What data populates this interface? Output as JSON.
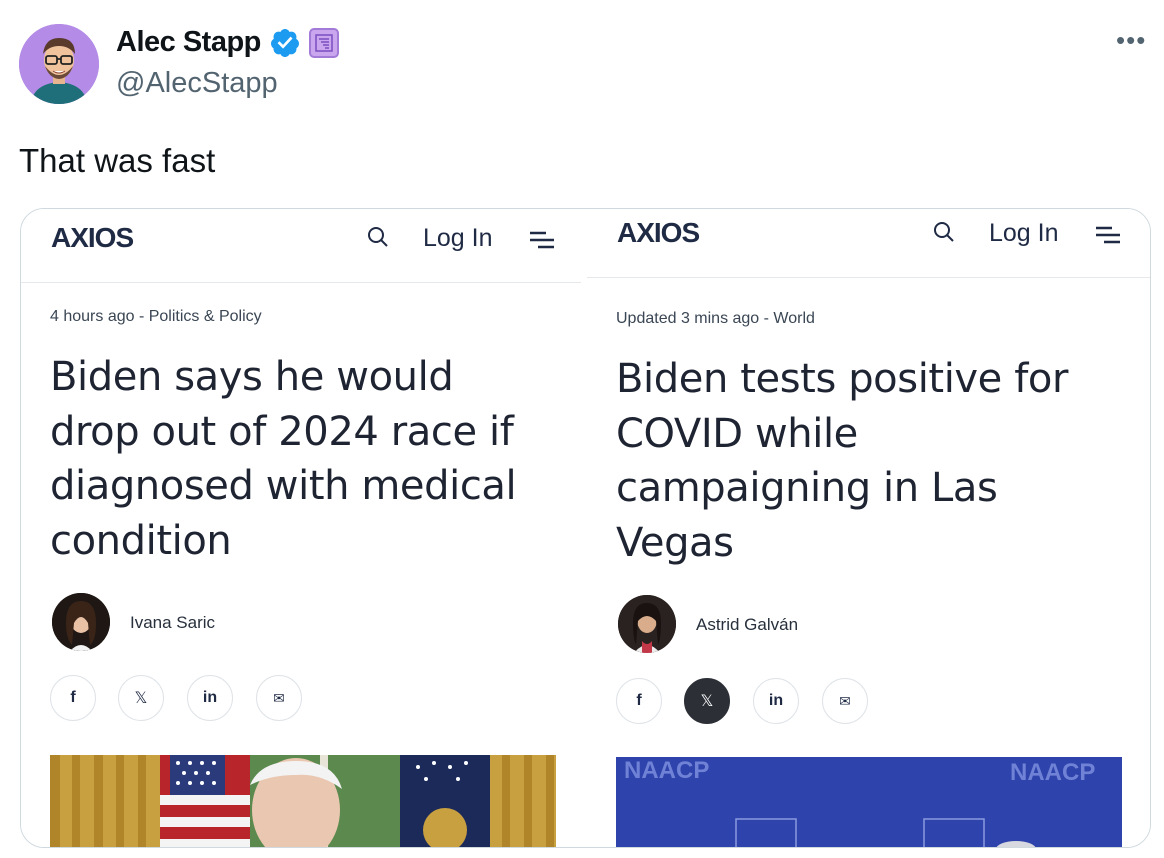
{
  "tweet": {
    "display_name": "Alec Stapp",
    "handle": "@AlecStapp",
    "more_label": "•••",
    "text": "That was fast"
  },
  "left_article": {
    "logo": "AXIOS",
    "login": "Log In",
    "meta": "4 hours ago - Politics & Policy",
    "headline": [
      "Biden says he would",
      "drop out of 2024 race if",
      "diagnosed with medical",
      "condition"
    ],
    "author": "Ivana Saric",
    "share": [
      "f",
      "𝕏",
      "in",
      "✉"
    ]
  },
  "right_article": {
    "logo": "AXIOS",
    "login": "Log In",
    "meta": "Updated 3 mins ago - World",
    "headline": [
      "Biden tests positive for",
      "COVID while",
      "campaigning in Las",
      "Vegas"
    ],
    "author": "Astrid Galván",
    "share": [
      "f",
      "𝕏",
      "in",
      "✉"
    ],
    "photo_text_left": "NAACP",
    "photo_text_right": "NAACP"
  },
  "colors": {
    "verified": "#1d9bf0",
    "axios_navy": "#1f2a44",
    "naacp_blue": "#2a3fa6"
  }
}
